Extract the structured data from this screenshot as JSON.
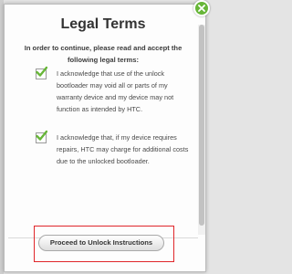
{
  "dialog": {
    "title": "Legal Terms",
    "intro": "In order to continue, please read and accept the following legal terms:",
    "terms": [
      {
        "checked": true,
        "text": "I acknowledge that use of the unlock bootloader may void all or parts of my warranty device and my device may not function as intended by HTC."
      },
      {
        "checked": true,
        "text": "I acknowledge that, if my device requires repairs, HTC may charge for additional costs due to the unlocked bootloader."
      }
    ],
    "proceed_label": "Proceed to Unlock Instructions"
  },
  "icons": {
    "close": "close-icon",
    "check": "checkmark-icon"
  },
  "colors": {
    "accent_green": "#67b638",
    "highlight_red": "#e0262a"
  }
}
